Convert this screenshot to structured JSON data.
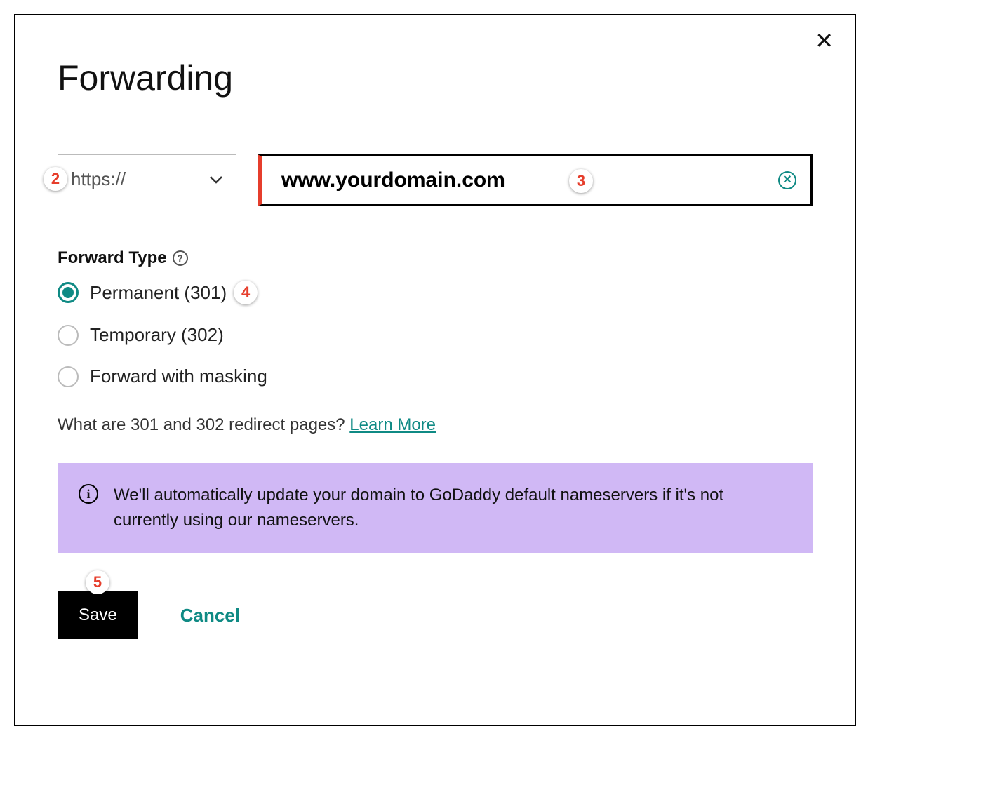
{
  "dialog": {
    "title": "Forwarding",
    "close_label": "✕"
  },
  "url": {
    "protocol": "https://",
    "domain_value": "www.yourdomain.com"
  },
  "forward_type": {
    "label": "Forward Type",
    "options": [
      {
        "label": "Permanent (301)",
        "selected": true
      },
      {
        "label": "Temporary (302)",
        "selected": false
      },
      {
        "label": "Forward with masking",
        "selected": false
      }
    ]
  },
  "hint": {
    "text": "What are 301 and 302 redirect pages? ",
    "link_label": "Learn More"
  },
  "info_banner": {
    "text": "We'll automatically update your domain to GoDaddy default nameservers if it's not currently using our nameservers."
  },
  "buttons": {
    "save": "Save",
    "cancel": "Cancel"
  },
  "annotations": {
    "a2": "2",
    "a3": "3",
    "a4": "4",
    "a5": "5"
  }
}
